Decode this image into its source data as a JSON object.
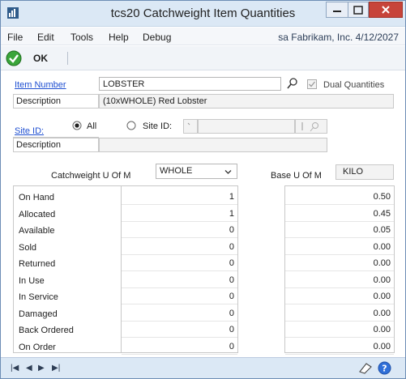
{
  "window": {
    "title": "tcs20 Catchweight Item Quantities",
    "controls": {
      "minimize": "minimize",
      "maximize": "maximize",
      "close": "close"
    }
  },
  "menu": {
    "items": [
      "File",
      "Edit",
      "Tools",
      "Help",
      "Debug"
    ],
    "company_info": "sa  Fabrikam, Inc. 4/12/2027"
  },
  "toolbar": {
    "ok_label": "OK"
  },
  "item": {
    "item_number_label": "Item Number",
    "item_number_value": "LOBSTER",
    "dual_quantities_label": "Dual Quantities",
    "dual_quantities_checked": true,
    "description_label": "Description",
    "description_value": "(10xWHOLE) Red Lobster"
  },
  "site": {
    "site_id_label": "Site ID:",
    "radio_all_label": "All",
    "radio_site_label": "Site ID:",
    "selected": "All",
    "description_label": "Description",
    "description_value": ""
  },
  "uom": {
    "catchweight_label": "Catchweight U Of M",
    "catchweight_value": "WHOLE",
    "base_label": "Base U Of M",
    "base_value": "KILO"
  },
  "quantities": {
    "rows": [
      {
        "label": "On Hand",
        "catchweight": "1",
        "base": "0.50"
      },
      {
        "label": "Allocated",
        "catchweight": "1",
        "base": "0.45"
      },
      {
        "label": "Available",
        "catchweight": "0",
        "base": "0.05"
      },
      {
        "label": "Sold",
        "catchweight": "0",
        "base": "0.00"
      },
      {
        "label": "Returned",
        "catchweight": "0",
        "base": "0.00"
      },
      {
        "label": "In Use",
        "catchweight": "0",
        "base": "0.00"
      },
      {
        "label": "In Service",
        "catchweight": "0",
        "base": "0.00"
      },
      {
        "label": "Damaged",
        "catchweight": "0",
        "base": "0.00"
      },
      {
        "label": "Back Ordered",
        "catchweight": "0",
        "base": "0.00"
      },
      {
        "label": "On Order",
        "catchweight": "0",
        "base": "0.00"
      }
    ]
  },
  "statusbar": {
    "nav_first": "|◀",
    "nav_prev": "◀",
    "nav_next": "▶",
    "nav_last": "▶|",
    "icons": [
      "note-icon",
      "help-icon"
    ]
  },
  "colors": {
    "link": "#1f4fd1",
    "titlebar": "#dbe8f5",
    "close_button": "#c7443a",
    "ok_check": "#3aa53a"
  }
}
